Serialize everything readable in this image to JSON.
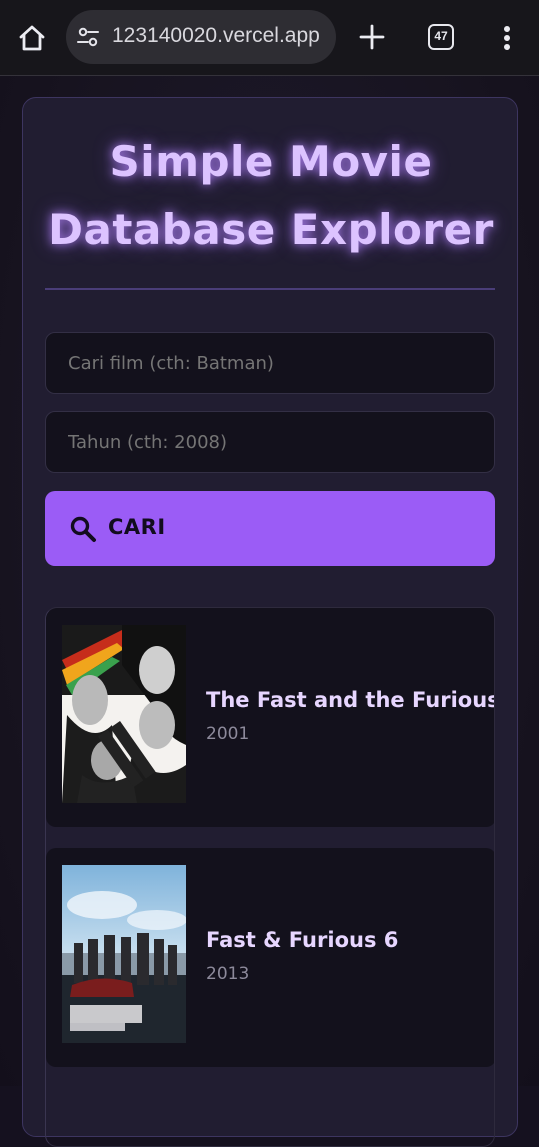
{
  "browser": {
    "url": "123140020.vercel.app",
    "tab_count": "47",
    "icons": [
      "home-icon",
      "site-settings-icon",
      "new-tab-icon",
      "tab-switcher-icon",
      "more-vert-icon"
    ]
  },
  "app": {
    "title": "Simple Movie Database Explorer",
    "search": {
      "query_placeholder": "Cari film (cth: Batman)",
      "year_placeholder": "Tahun (cth: 2008)",
      "button_label": "CARI",
      "button_icon": "search-icon"
    },
    "results": [
      {
        "title": "The Fast and the Furious",
        "year": "2001"
      },
      {
        "title": "Fast & Furious 6",
        "year": "2013"
      }
    ]
  },
  "colors": {
    "accent": "#9b5cf6",
    "title_glow": "#dcc3ff",
    "card_bg": "#211d31",
    "result_bg": "#13111c"
  }
}
